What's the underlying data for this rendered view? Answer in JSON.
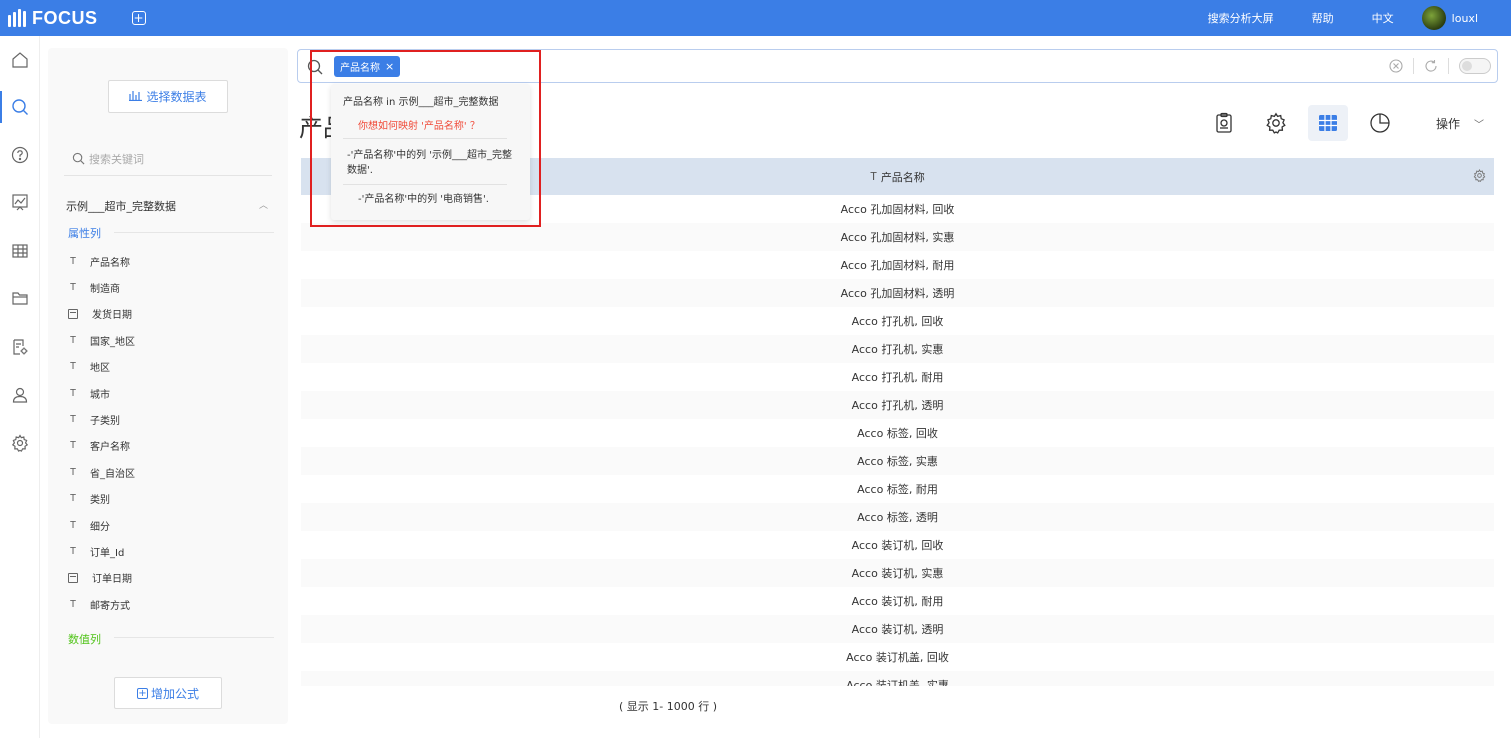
{
  "app": {
    "logo_text": "FOCUS",
    "add_glyph": "+"
  },
  "topbar": {
    "search_screen": "搜索分析大屏",
    "help": "帮助",
    "language": "中文",
    "username": "louxl"
  },
  "leftnav": {
    "items": [
      "home-icon",
      "search-icon",
      "help-circle-icon",
      "chart-icon",
      "table-icon",
      "folder-icon",
      "settings-doc-icon",
      "user-icon",
      "gear-icon"
    ],
    "active": "search-icon"
  },
  "datapanel": {
    "select_table_label": "选择数据表",
    "keyword_placeholder": "搜索关键词",
    "dataset_name": "示例___超市_完整数据",
    "attribute_section": "属性列",
    "numeric_section": "数值列",
    "columns": [
      {
        "name": "产品名称",
        "type": "text"
      },
      {
        "name": "制造商",
        "type": "text"
      },
      {
        "name": "发货日期",
        "type": "date"
      },
      {
        "name": "国家_地区",
        "type": "text"
      },
      {
        "name": "地区",
        "type": "text"
      },
      {
        "name": "城市",
        "type": "text"
      },
      {
        "name": "子类别",
        "type": "text"
      },
      {
        "name": "客户名称",
        "type": "text"
      },
      {
        "name": "省_自治区",
        "type": "text"
      },
      {
        "name": "类别",
        "type": "text"
      },
      {
        "name": "细分",
        "type": "text"
      },
      {
        "name": "订单_Id",
        "type": "text"
      },
      {
        "name": "订单日期",
        "type": "date"
      },
      {
        "name": "邮寄方式",
        "type": "text"
      }
    ],
    "add_formula_label": "增加公式"
  },
  "search": {
    "token": "产品名称",
    "token_close": "×"
  },
  "dropdown": {
    "header": "产品名称 in 示例___超市_完整数据",
    "question": "你想如何映射 '产品名称' ？",
    "options": [
      "-'产品名称'中的列 '示例___超市_完整数据'.",
      "-'产品名称'中的列 '电商销售'."
    ]
  },
  "page": {
    "title": "产品名称",
    "operations": "操作"
  },
  "table": {
    "header": "产品名称",
    "rows": [
      "Acco 孔加固材料, 回收",
      "Acco 孔加固材料, 实惠",
      "Acco 孔加固材料, 耐用",
      "Acco 孔加固材料, 透明",
      "Acco 打孔机, 回收",
      "Acco 打孔机, 实惠",
      "Acco 打孔机, 耐用",
      "Acco 打孔机, 透明",
      "Acco 标签, 回收",
      "Acco 标签, 实惠",
      "Acco 标签, 耐用",
      "Acco 标签, 透明",
      "Acco 装订机, 回收",
      "Acco 装订机, 实惠",
      "Acco 装订机, 耐用",
      "Acco 装订机, 透明",
      "Acco 装订机盖, 回收",
      "Acco 装订机盖, 实惠"
    ],
    "footer": "( 显示 1- 1000 行 )"
  },
  "colors": {
    "accent": "#3b7ee6",
    "numeric": "#52c41a",
    "warning": "#f04b3a",
    "highlight": "#e02020"
  }
}
